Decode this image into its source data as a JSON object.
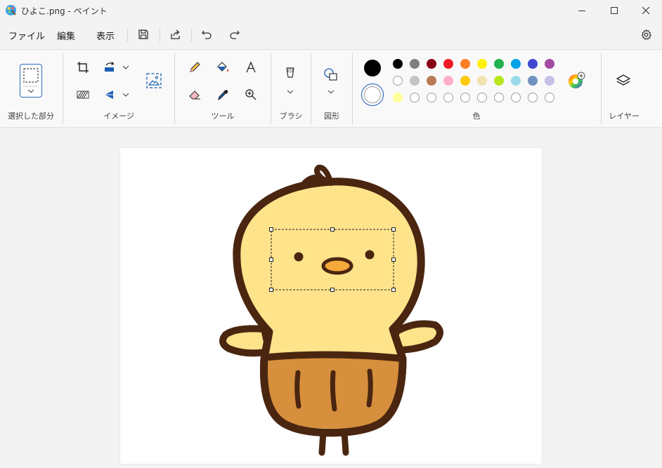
{
  "window": {
    "title": "ひよこ.png - ペイント"
  },
  "menu": {
    "file": "ファイル",
    "edit": "編集",
    "view": "表示"
  },
  "groups": {
    "selection": "選択した部分",
    "image": "イメージ",
    "tools": "ツール",
    "brushes": "ブラシ",
    "shapes": "図形",
    "colors": "色",
    "layers": "レイヤー"
  },
  "colors": {
    "primary": "#000000",
    "secondary": "#ffffff",
    "row1": [
      "#000000",
      "#7f7f7f",
      "#880015",
      "#ed1c24",
      "#ff7f27",
      "#fff200",
      "#22b14c",
      "#00a2e8",
      "#3f48cc",
      "#a349a4"
    ],
    "row2": [
      "#ffffff",
      "#c3c3c3",
      "#b97a57",
      "#ffaec9",
      "#ffc90e",
      "#efe4b0",
      "#b5e61d",
      "#99d9ea",
      "#7092be",
      "#c8bfe7"
    ],
    "row3": [
      "#ffff99",
      "",
      "",
      "",
      "",
      "",
      "",
      "",
      "",
      ""
    ]
  }
}
